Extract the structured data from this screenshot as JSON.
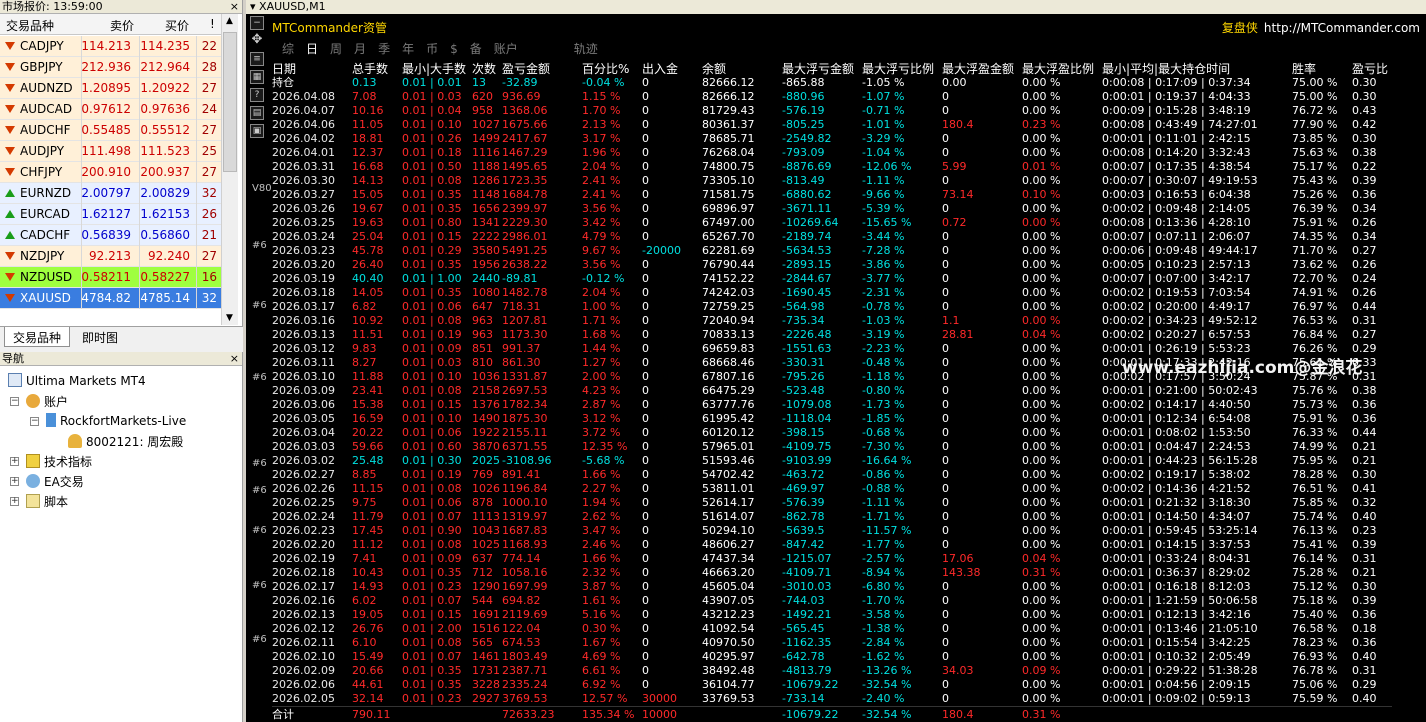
{
  "market_watch": {
    "title": "市场报价: 13:59:00",
    "close": "×",
    "hdr_symbol": "交易品种",
    "hdr_bid": "卖价",
    "hdr_ask": "买价",
    "hdr_spread": "!",
    "rows": [
      {
        "dir": "down",
        "symbol": "CADJPY",
        "bid": "114.213",
        "ask": "114.235",
        "spread": "22",
        "color": "#cc0000",
        "bg": "#fff0d8"
      },
      {
        "dir": "down",
        "symbol": "GBPJPY",
        "bid": "212.936",
        "ask": "212.964",
        "spread": "28",
        "color": "#cc0000",
        "bg": "#fff0d8"
      },
      {
        "dir": "down",
        "symbol": "AUDNZD",
        "bid": "1.20895",
        "ask": "1.20922",
        "spread": "27",
        "color": "#cc0000",
        "bg": "#fff0d8"
      },
      {
        "dir": "down",
        "symbol": "AUDCAD",
        "bid": "0.97612",
        "ask": "0.97636",
        "spread": "24",
        "color": "#cc0000",
        "bg": "#fff0d8"
      },
      {
        "dir": "down",
        "symbol": "AUDCHF",
        "bid": "0.55485",
        "ask": "0.55512",
        "spread": "27",
        "color": "#cc0000",
        "bg": "#fff0d8"
      },
      {
        "dir": "down",
        "symbol": "AUDJPY",
        "bid": "111.498",
        "ask": "111.523",
        "spread": "25",
        "color": "#cc0000",
        "bg": "#fff0d8"
      },
      {
        "dir": "down",
        "symbol": "CHFJPY",
        "bid": "200.910",
        "ask": "200.937",
        "spread": "27",
        "color": "#cc0000",
        "bg": "#fff0d8"
      },
      {
        "dir": "up",
        "symbol": "EURNZD",
        "bid": "2.00797",
        "ask": "2.00829",
        "spread": "32",
        "color": "#0000cc",
        "bg": "#e8f0ff"
      },
      {
        "dir": "up",
        "symbol": "EURCAD",
        "bid": "1.62127",
        "ask": "1.62153",
        "spread": "26",
        "color": "#0000cc",
        "bg": "#e8f0ff"
      },
      {
        "dir": "up",
        "symbol": "CADCHF",
        "bid": "0.56839",
        "ask": "0.56860",
        "spread": "21",
        "color": "#0000cc",
        "bg": "#e8f0ff"
      },
      {
        "dir": "down",
        "symbol": "NZDJPY",
        "bid": "92.213",
        "ask": "92.240",
        "spread": "27",
        "color": "#cc0000",
        "bg": "#fff0d8"
      },
      {
        "dir": "down",
        "symbol": "NZDUSD",
        "bid": "0.58211",
        "ask": "0.58227",
        "spread": "16",
        "color": "#cc0000",
        "bg": "#9fff3f"
      },
      {
        "dir": "down",
        "symbol": "XAUUSD",
        "bid": "4784.82",
        "ask": "4785.14",
        "spread": "32",
        "color": "#ffffff",
        "bg": "#3a7de0"
      }
    ],
    "tabs": [
      "交易品种",
      "即时图"
    ]
  },
  "navigator": {
    "title": "导航",
    "close": "×",
    "root": "Ultima Markets MT4",
    "accounts": "账户",
    "server": "RockfortMarkets-Live",
    "account": "8002121: 周宏殿",
    "indicators": "技术指标",
    "ea": "EA交易",
    "scripts": "脚本"
  },
  "chart": {
    "title": "XAUUSD,M1",
    "mtc": "MTCommander资管",
    "fupan": "复盘侠",
    "url": "http://MTCommander.com",
    "watermark": "www.eazhijia.com@金浪花",
    "tabs": [
      "综",
      "日",
      "周",
      "月",
      "季",
      "年",
      "币",
      "$",
      "备",
      "账户",
      "",
      "轨迹"
    ],
    "active_tab": 1,
    "side_marks": [
      "#6",
      "#6",
      "#6",
      "#6",
      "#6",
      "#6",
      "#6",
      "#6",
      "V80"
    ],
    "headers": [
      "日期",
      "总手数",
      "最小|大手数",
      "次数",
      "盈亏金额",
      "百分比%",
      "出入金",
      "余额",
      "最大浮亏金额",
      "最大浮亏比例",
      "最大浮盈金额",
      "最大浮盈比例",
      "最小|平均|最大持仓时间",
      "胜率",
      "盈亏比"
    ],
    "hold_row": [
      "持仓",
      "0.13",
      "0.01 | 0.01",
      "13",
      "-32.89",
      "-0.04 %",
      "0",
      "82666.12",
      "-865.88",
      "-1.05 %",
      "0.00",
      "0.00 %",
      "0:00:08 | 0:17:09 | 0:37:34",
      "75.00 %",
      "0.30"
    ],
    "rows": [
      [
        "2026.04.08",
        "7.08",
        "0.01 | 0.03",
        "620",
        "936.69",
        "1.15 %",
        "0",
        "82666.12",
        "-880.96",
        "-1.07 %",
        "0",
        "0.00 %",
        "0:00:01 | 0:19:37 | 4:04:33",
        "75.00 %",
        "0.30"
      ],
      [
        "2026.04.07",
        "10.16",
        "0.01 | 0.04",
        "958",
        "1368.06",
        "1.70 %",
        "0",
        "81729.43",
        "-576.19",
        "-0.71 %",
        "0",
        "0.00 %",
        "0:00:09 | 0:15:28 | 3:48:19",
        "76.72 %",
        "0.43"
      ],
      [
        "2026.04.06",
        "11.05",
        "0.01 | 0.10",
        "1027",
        "1675.66",
        "2.13 %",
        "0",
        "80361.37",
        "-805.25",
        "-1.01 %",
        "180.4",
        "0.23 %",
        "0:00:08 | 0:43:49 | 74:27:01",
        "77.90 %",
        "0.42"
      ],
      [
        "2026.04.02",
        "18.81",
        "0.01 | 0.26",
        "1499",
        "2417.67",
        "3.17 %",
        "0",
        "78685.71",
        "-2549.82",
        "-3.29 %",
        "0",
        "0.00 %",
        "0:00:01 | 0:11:01 | 2:42:15",
        "73.85 %",
        "0.30"
      ],
      [
        "2026.04.01",
        "12.37",
        "0.01 | 0.18",
        "1116",
        "1467.29",
        "1.96 %",
        "0",
        "76268.04",
        "-793.09",
        "-1.04 %",
        "0",
        "0.00 %",
        "0:00:08 | 0:14:20 | 3:32:43",
        "75.63 %",
        "0.38"
      ],
      [
        "2026.03.31",
        "16.68",
        "0.01 | 0.50",
        "1188",
        "1495.65",
        "2.04 %",
        "0",
        "74800.75",
        "-8876.69",
        "-12.06 %",
        "5.99",
        "0.01 %",
        "0:00:07 | 0:17:35 | 4:38:54",
        "75.17 %",
        "0.22"
      ],
      [
        "2026.03.30",
        "14.13",
        "0.01 | 0.08",
        "1286",
        "1723.35",
        "2.41 %",
        "0",
        "73305.10",
        "-813.49",
        "-1.11 %",
        "0",
        "0.00 %",
        "0:00:07 | 0:30:07 | 49:19:53",
        "75.43 %",
        "0.39"
      ],
      [
        "2026.03.27",
        "15.05",
        "0.01 | 0.35",
        "1148",
        "1684.78",
        "2.41 %",
        "0",
        "71581.75",
        "-6880.62",
        "-9.66 %",
        "73.14",
        "0.10 %",
        "0:00:03 | 0:16:53 | 6:04:38",
        "75.26 %",
        "0.36"
      ],
      [
        "2026.03.26",
        "19.67",
        "0.01 | 0.35",
        "1656",
        "2399.97",
        "3.56 %",
        "0",
        "69896.97",
        "-3671.11",
        "-5.39 %",
        "0",
        "0.00 %",
        "0:00:02 | 0:09:48 | 2:14:05",
        "76.39 %",
        "0.34"
      ],
      [
        "2026.03.25",
        "19.63",
        "0.01 | 0.80",
        "1341",
        "2229.30",
        "3.42 %",
        "0",
        "67497.00",
        "-10269.64",
        "-15.65 %",
        "0.72",
        "0.00 %",
        "0:00:08 | 0:13:36 | 4:28:10",
        "75.91 %",
        "0.26"
      ],
      [
        "2026.03.24",
        "25.04",
        "0.01 | 0.15",
        "2222",
        "2986.01",
        "4.79 %",
        "0",
        "65267.70",
        "-2189.74",
        "-3.44 %",
        "0",
        "0.00 %",
        "0:00:07 | 0:07:11 | 2:06:07",
        "74.35 %",
        "0.34"
      ],
      [
        "2026.03.23",
        "45.78",
        "0.01 | 0.29",
        "3580",
        "5491.25",
        "9.67 %",
        "-20000",
        "62281.69",
        "-5634.53",
        "-7.28 %",
        "0",
        "0.00 %",
        "0:00:06 | 0:09:48 | 49:44:17",
        "71.70 %",
        "0.27"
      ],
      [
        "2026.03.20",
        "26.40",
        "0.01 | 0.35",
        "1956",
        "2638.22",
        "3.56 %",
        "0",
        "76790.44",
        "-2893.15",
        "-3.86 %",
        "0",
        "0.00 %",
        "0:00:05 | 0:10:23 | 2:57:13",
        "73.62 %",
        "0.26"
      ],
      [
        "2026.03.19",
        "40.40",
        "0.01 | 1.00",
        "2440",
        "-89.81",
        "-0.12 %",
        "0",
        "74152.22",
        "-2844.67",
        "-3.77 %",
        "0",
        "0.00 %",
        "0:00:07 | 0:07:00 | 3:42:17",
        "72.70 %",
        "0.24"
      ],
      [
        "2026.03.18",
        "14.05",
        "0.01 | 0.35",
        "1080",
        "1482.78",
        "2.04 %",
        "0",
        "74242.03",
        "-1690.45",
        "-2.31 %",
        "0",
        "0.00 %",
        "0:00:02 | 0:19:53 | 7:03:54",
        "74.91 %",
        "0.26"
      ],
      [
        "2026.03.17",
        "6.82",
        "0.01 | 0.06",
        "647",
        "718.31",
        "1.00 %",
        "0",
        "72759.25",
        "-564.98",
        "-0.78 %",
        "0",
        "0.00 %",
        "0:00:02 | 0:20:00 | 4:49:17",
        "76.97 %",
        "0.44"
      ],
      [
        "2026.03.16",
        "10.92",
        "0.01 | 0.08",
        "963",
        "1207.81",
        "1.71 %",
        "0",
        "72040.94",
        "-735.34",
        "-1.03 %",
        "1.1",
        "0.00 %",
        "0:00:02 | 0:34:23 | 49:52:12",
        "76.53 %",
        "0.31"
      ],
      [
        "2026.03.13",
        "11.51",
        "0.01 | 0.19",
        "963",
        "1173.30",
        "1.68 %",
        "0",
        "70833.13",
        "-2226.48",
        "-3.19 %",
        "28.81",
        "0.04 %",
        "0:00:02 | 0:20:27 | 6:57:53",
        "76.84 %",
        "0.27"
      ],
      [
        "2026.03.12",
        "9.83",
        "0.01 | 0.09",
        "851",
        "991.37",
        "1.44 %",
        "0",
        "69659.83",
        "-1551.63",
        "-2.23 %",
        "0",
        "0.00 %",
        "0:00:01 | 0:26:19 | 5:53:23",
        "76.26 %",
        "0.29"
      ],
      [
        "2026.03.11",
        "8.27",
        "0.01 | 0.03",
        "810",
        "861.30",
        "1.27 %",
        "0",
        "68668.46",
        "-330.31",
        "-0.48 %",
        "0",
        "0.00 %",
        "0:00:01 | 0:17:33 | 2:42:16",
        "75.61 %",
        "0.33"
      ],
      [
        "2026.03.10",
        "11.88",
        "0.01 | 0.10",
        "1036",
        "1331.87",
        "2.00 %",
        "0",
        "67807.16",
        "-795.26",
        "-1.18 %",
        "0",
        "0.00 %",
        "0:00:02 | 0:17:57 | 3:50:24",
        "75.87 %",
        "0.31"
      ],
      [
        "2026.03.09",
        "23.41",
        "0.01 | 0.08",
        "2158",
        "2697.53",
        "4.23 %",
        "0",
        "66475.29",
        "-523.48",
        "-0.80 %",
        "0",
        "0.00 %",
        "0:00:01 | 0:21:00 | 50:02:43",
        "75.76 %",
        "0.38"
      ],
      [
        "2026.03.06",
        "15.38",
        "0.01 | 0.15",
        "1376",
        "1782.34",
        "2.87 %",
        "0",
        "63777.76",
        "-1079.08",
        "-1.73 %",
        "0",
        "0.00 %",
        "0:00:02 | 0:14:17 | 4:40:50",
        "75.73 %",
        "0.36"
      ],
      [
        "2026.03.05",
        "16.59",
        "0.01 | 0.10",
        "1490",
        "1875.30",
        "3.12 %",
        "0",
        "61995.42",
        "-1118.04",
        "-1.85 %",
        "0",
        "0.00 %",
        "0:00:01 | 0:12:34 | 6:54:08",
        "75.91 %",
        "0.36"
      ],
      [
        "2026.03.04",
        "20.22",
        "0.01 | 0.06",
        "1922",
        "2155.11",
        "3.72 %",
        "0",
        "60120.12",
        "-398.15",
        "-0.68 %",
        "0",
        "0.00 %",
        "0:00:01 | 0:08:02 | 1:53:50",
        "76.33 %",
        "0.44"
      ],
      [
        "2026.03.03",
        "59.66",
        "0.01 | 0.60",
        "3870",
        "6371.55",
        "12.35 %",
        "0",
        "57965.01",
        "-4109.75",
        "-7.30 %",
        "0",
        "0.00 %",
        "0:00:01 | 0:04:47 | 2:24:53",
        "74.99 %",
        "0.21"
      ],
      [
        "2026.03.02",
        "25.48",
        "0.01 | 0.30",
        "2025",
        "-3108.96",
        "-5.68 %",
        "0",
        "51593.46",
        "-9103.99",
        "-16.64 %",
        "0",
        "0.00 %",
        "0:00:01 | 0:44:23 | 56:15:28",
        "75.95 %",
        "0.21"
      ],
      [
        "2026.02.27",
        "8.85",
        "0.01 | 0.19",
        "769",
        "891.41",
        "1.66 %",
        "0",
        "54702.42",
        "-463.72",
        "-0.86 %",
        "0",
        "0.00 %",
        "0:00:02 | 0:19:17 | 5:38:02",
        "78.28 %",
        "0.30"
      ],
      [
        "2026.02.26",
        "11.15",
        "0.01 | 0.08",
        "1026",
        "1196.84",
        "2.27 %",
        "0",
        "53811.01",
        "-469.97",
        "-0.88 %",
        "0",
        "0.00 %",
        "0:00:02 | 0:14:36 | 4:21:52",
        "76.51 %",
        "0.41"
      ],
      [
        "2026.02.25",
        "9.75",
        "0.01 | 0.06",
        "878",
        "1000.10",
        "1.94 %",
        "0",
        "52614.17",
        "-576.39",
        "-1.11 %",
        "0",
        "0.00 %",
        "0:00:01 | 0:21:32 | 3:18:30",
        "75.85 %",
        "0.32"
      ],
      [
        "2026.02.24",
        "11.79",
        "0.01 | 0.07",
        "1113",
        "1319.97",
        "2.62 %",
        "0",
        "51614.07",
        "-862.78",
        "-1.71 %",
        "0",
        "0.00 %",
        "0:00:01 | 0:14:50 | 4:34:07",
        "75.74 %",
        "0.40"
      ],
      [
        "2026.02.23",
        "17.45",
        "0.01 | 0.90",
        "1043",
        "1687.83",
        "3.47 %",
        "0",
        "50294.10",
        "-5639.5",
        "-11.57 %",
        "0",
        "0.00 %",
        "0:00:01 | 0:59:45 | 53:25:14",
        "76.13 %",
        "0.23"
      ],
      [
        "2026.02.20",
        "11.12",
        "0.01 | 0.08",
        "1025",
        "1168.93",
        "2.46 %",
        "0",
        "48606.27",
        "-847.42",
        "-1.77 %",
        "0",
        "0.00 %",
        "0:00:01 | 0:14:15 | 3:37:53",
        "75.41 %",
        "0.39"
      ],
      [
        "2026.02.19",
        "7.41",
        "0.01 | 0.09",
        "637",
        "774.14",
        "1.66 %",
        "0",
        "47437.34",
        "-1215.07",
        "-2.57 %",
        "17.06",
        "0.04 %",
        "0:00:01 | 0:33:24 | 8:04:31",
        "76.14 %",
        "0.31"
      ],
      [
        "2026.02.18",
        "10.43",
        "0.01 | 0.35",
        "712",
        "1058.16",
        "2.32 %",
        "0",
        "46663.20",
        "-4109.71",
        "-8.94 %",
        "143.38",
        "0.31 %",
        "0:00:01 | 0:36:37 | 8:29:02",
        "75.28 %",
        "0.21"
      ],
      [
        "2026.02.17",
        "14.93",
        "0.01 | 0.23",
        "1290",
        "1697.99",
        "3.87 %",
        "0",
        "45605.04",
        "-3010.03",
        "-6.80 %",
        "0",
        "0.00 %",
        "0:00:01 | 0:16:18 | 8:12:03",
        "75.12 %",
        "0.30"
      ],
      [
        "2026.02.16",
        "6.02",
        "0.01 | 0.07",
        "544",
        "694.82",
        "1.61 %",
        "0",
        "43907.05",
        "-744.03",
        "-1.70 %",
        "0",
        "0.00 %",
        "0:00:01 | 1:21:59 | 50:06:58",
        "75.18 %",
        "0.39"
      ],
      [
        "2026.02.13",
        "19.05",
        "0.01 | 0.15",
        "1691",
        "2119.69",
        "5.16 %",
        "0",
        "43212.23",
        "-1492.21",
        "-3.58 %",
        "0",
        "0.00 %",
        "0:00:01 | 0:12:13 | 3:42:16",
        "75.40 %",
        "0.36"
      ],
      [
        "2026.02.12",
        "26.76",
        "0.01 | 2.00",
        "1516",
        "122.04",
        "0.30 %",
        "0",
        "41092.54",
        "-565.45",
        "-1.38 %",
        "0",
        "0.00 %",
        "0:00:01 | 0:13:46 | 21:05:10",
        "76.58 %",
        "0.18"
      ],
      [
        "2026.02.11",
        "6.10",
        "0.01 | 0.08",
        "565",
        "674.53",
        "1.67 %",
        "0",
        "40970.50",
        "-1162.35",
        "-2.84 %",
        "0",
        "0.00 %",
        "0:00:01 | 0:15:54 | 3:42:25",
        "78.23 %",
        "0.36"
      ],
      [
        "2026.02.10",
        "15.49",
        "0.01 | 0.07",
        "1461",
        "1803.49",
        "4.69 %",
        "0",
        "40295.97",
        "-642.78",
        "-1.62 %",
        "0",
        "0.00 %",
        "0:00:01 | 0:10:32 | 2:05:49",
        "76.93 %",
        "0.40"
      ],
      [
        "2026.02.09",
        "20.66",
        "0.01 | 0.35",
        "1731",
        "2387.71",
        "6.61 %",
        "0",
        "38492.48",
        "-4813.79",
        "-13.26 %",
        "34.03",
        "0.09 %",
        "0:00:01 | 0:29:22 | 51:38:28",
        "76.78 %",
        "0.31"
      ],
      [
        "2026.02.06",
        "44.61",
        "0.01 | 0.35",
        "3228",
        "2335.24",
        "6.92 %",
        "0",
        "36104.77",
        "-10679.22",
        "-32.54 %",
        "0",
        "0.00 %",
        "0:00:01 | 0:04:56 | 2:09:15",
        "75.06 %",
        "0.29"
      ],
      [
        "2026.02.05",
        "32.14",
        "0.01 | 0.23",
        "2927",
        "3769.53",
        "12.57 %",
        "30000",
        "33769.53",
        "-733.14",
        "-2.40 %",
        "0",
        "0.00 %",
        "0:00:01 | 0:09:02 | 0:59:13",
        "75.59 %",
        "0.40"
      ]
    ],
    "total_row": [
      "合计",
      "790.11",
      "",
      "",
      "72633.23",
      "135.34 %",
      "10000",
      "",
      "-10679.22",
      "-32.54 %",
      "180.4",
      "0.31 %",
      "",
      "",
      ""
    ]
  }
}
